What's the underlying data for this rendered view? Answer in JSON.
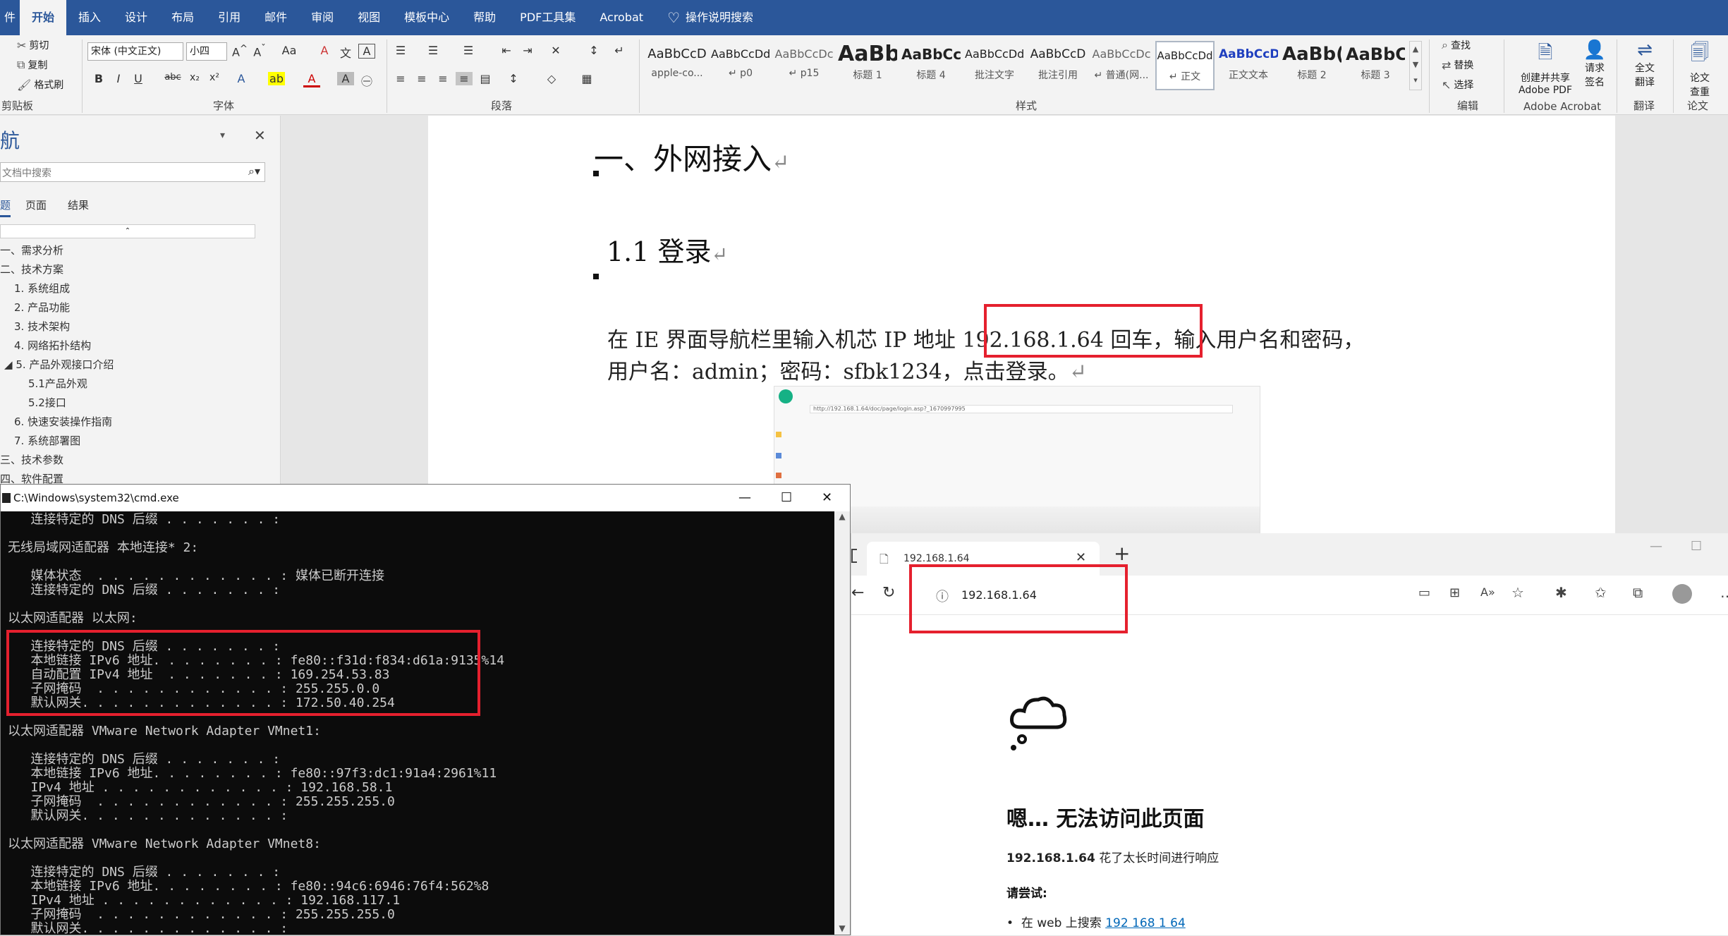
{
  "ribbon_tabs": [
    "件",
    "开始",
    "插入",
    "设计",
    "布局",
    "引用",
    "邮件",
    "审阅",
    "视图",
    "模板中心",
    "帮助",
    "PDF工具集",
    "Acrobat"
  ],
  "tell_me": "操作说明搜索",
  "clipboard": {
    "cut": "剪切",
    "copy": "复制",
    "format_painter": "格式刷",
    "label": "剪贴板"
  },
  "font": {
    "name": "宋体 (中文正文)",
    "size": "小四",
    "label": "字体"
  },
  "paragraph_label": "段落",
  "styles": {
    "label": "样式",
    "items": [
      {
        "preview": "AaBbCcD",
        "name": "apple-co..."
      },
      {
        "preview": "AaBbCcDd",
        "name": "↵ p0"
      },
      {
        "preview": "AaBbCcDc",
        "name": "↵ p15"
      },
      {
        "preview": "AaBb",
        "name": "标题 1"
      },
      {
        "preview": "AaBbCc",
        "name": "标题 4"
      },
      {
        "preview": "AaBbCcDd",
        "name": "批注文字"
      },
      {
        "preview": "AaBbCcD",
        "name": "批注引用"
      },
      {
        "preview": "AaBbCcDc",
        "name": "↵ 普通(网..."
      },
      {
        "preview": "AaBbCcDd",
        "name": "↵ 正文"
      },
      {
        "preview": "AaBbCcD",
        "name": "正文文本"
      },
      {
        "preview": "AaBb(",
        "name": "标题 2"
      },
      {
        "preview": "AaBbC",
        "name": "标题 3"
      }
    ]
  },
  "editing": {
    "find": "查找",
    "replace": "替换",
    "select": "选择",
    "label": "编辑"
  },
  "acrobat": {
    "create": "创建并共享",
    "create2": "Adobe PDF",
    "request": "请求",
    "request2": "签名",
    "label": "Adobe Acrobat"
  },
  "translate": {
    "btn": "全文",
    "btn2": "翻译",
    "label": "翻译"
  },
  "thesis": {
    "btn": "论文",
    "btn2": "查重",
    "label": "论文"
  },
  "nav": {
    "title": "航",
    "search_placeholder": "文档中搜索",
    "tabs": [
      "题",
      "页面",
      "结果"
    ],
    "items": [
      "一、需求分析",
      "二、技术方案",
      "1. 系统组成",
      "2. 产品功能",
      "3. 技术架构",
      "4. 网络拓扑结构",
      "5. 产品外观接口介绍",
      "5.1产品外观",
      "5.2接口",
      "6. 快速安装操作指南",
      "7. 系统部署图",
      "三、技术参数",
      "四、软件配置"
    ]
  },
  "doc": {
    "heading1": "一、外网接入",
    "heading2": "1.1 登录",
    "para_line1": "在 IE 界面导航栏里输入机芯 IP 地址 192.168.1.64 回车，输入用户名和密码，",
    "para_line2": "用户名：admin；密码：sfbk1234，点击登录。",
    "para_mark": "↵"
  },
  "cmd": {
    "title": "C:\\Windows\\system32\\cmd.exe",
    "lines": [
      "   连接特定的 DNS 后缀 . . . . . . . :",
      "",
      "无线局域网适配器 本地连接* 2:",
      "",
      "   媒体状态  . . . . . . . . . . . . : 媒体已断开连接",
      "   连接特定的 DNS 后缀 . . . . . . . :",
      "",
      "以太网适配器 以太网:",
      "",
      "   连接特定的 DNS 后缀 . . . . . . . :",
      "   本地链接 IPv6 地址. . . . . . . . : fe80::f31d:f834:d61a:9135%14",
      "   自动配置 IPv4 地址  . . . . . . . : 169.254.53.83",
      "   子网掩码  . . . . . . . . . . . . : 255.255.0.0",
      "   默认网关. . . . . . . . . . . . . : 172.50.40.254",
      "",
      "以太网适配器 VMware Network Adapter VMnet1:",
      "",
      "   连接特定的 DNS 后缀 . . . . . . . :",
      "   本地链接 IPv6 地址. . . . . . . . : fe80::97f3:dc1:91a4:2961%11",
      "   IPv4 地址 . . . . . . . . . . . . : 192.168.58.1",
      "   子网掩码  . . . . . . . . . . . . : 255.255.255.0",
      "   默认网关. . . . . . . . . . . . . :",
      "",
      "以太网适配器 VMware Network Adapter VMnet8:",
      "",
      "   连接特定的 DNS 后缀 . . . . . . . :",
      "   本地链接 IPv6 地址. . . . . . . . : fe80::94c6:6946:76f4:562%8",
      "   IPv4 地址 . . . . . . . . . . . . : 192.168.117.1",
      "   子网掩码  . . . . . . . . . . . . : 255.255.255.0",
      "   默认网关. . . . . . . . . . . . . :"
    ]
  },
  "edge": {
    "tab_title": "192.168.1.64",
    "address": "192.168.1.64",
    "error_title": "嗯… 无法访问此页面",
    "error_host": "192.168.1.64",
    "error_desc": " 花了太长时间进行响应",
    "try_label": "请尝试:",
    "suggestion_prefix": "在 web 上搜索 ",
    "suggestion_link": "192 168 1 64"
  },
  "embedded_screenshot": {
    "url": "http://192.168.1.64/doc/page/login.asp?_1670997995"
  },
  "colors": {
    "ribbon_blue": "#2b579a",
    "highlight_red": "#e5202e",
    "cmd_bg": "#0c0c0c",
    "link": "#0067b8"
  }
}
